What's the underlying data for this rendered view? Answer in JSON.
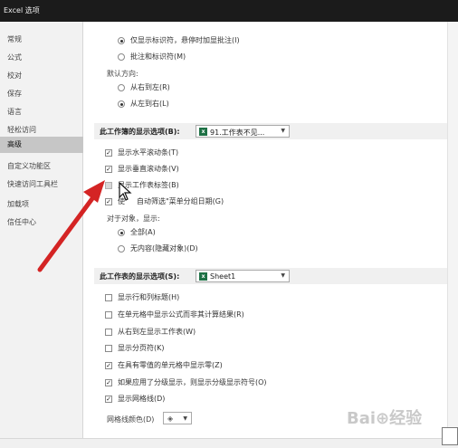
{
  "window": {
    "title": "Excel 选项"
  },
  "sidebar": {
    "items": [
      {
        "label": "常规"
      },
      {
        "label": "公式"
      },
      {
        "label": "校对"
      },
      {
        "label": "保存"
      },
      {
        "label": "语言"
      },
      {
        "label": "轻松访问"
      },
      {
        "label": "高级",
        "active": true
      },
      {
        "label": "自定义功能区"
      },
      {
        "label": "快速访问工具栏"
      },
      {
        "label": "加载项"
      },
      {
        "label": "信任中心"
      }
    ]
  },
  "comments_section": {
    "option_indicators_only": "仅显示标识符，悬停时加显批注(I)",
    "option_comments_and_indicators": "批注和标识符(M)"
  },
  "direction_section": {
    "label": "默认方向:",
    "option_right_to_left": "从右到左(R)",
    "option_left_to_right": "从左到右(L)"
  },
  "workbook_display": {
    "header": "此工作簿的显示选项(B):",
    "selected": "91.工作表不见...",
    "show_horizontal_scrollbar": "显示水平滚动条(T)",
    "show_vertical_scrollbar": "显示垂直滚动条(V)",
    "show_sheet_tabs": "显示工作表标签(B)",
    "group_dates_prefix": "使",
    "group_dates_suffix": "自动筛选\"菜单分组日期(G)",
    "for_objects_label": "对于对象，显示:",
    "objects_all": "全部(A)",
    "objects_none": "无内容(隐藏对象)(D)"
  },
  "worksheet_display": {
    "header": "此工作表的显示选项(S):",
    "selected": "Sheet1",
    "show_row_col_headers": "显示行和列标题(H)",
    "show_formulas": "在单元格中显示公式而非其计算结果(R)",
    "right_to_left": "从右到左显示工作表(W)",
    "show_page_breaks": "显示分页符(K)",
    "show_zero": "在具有零值的单元格中显示零(Z)",
    "show_outline_symbols": "如果应用了分级显示，则显示分级显示符号(O)",
    "show_gridlines": "显示网格线(D)",
    "gridline_color_label": "网格线颜色(D)"
  },
  "watermark": "Bai⊕经验",
  "colors": {
    "arrow": "#d42424",
    "titlebar": "#1b1b1b",
    "excel_green": "#1e7145"
  },
  "icons": {
    "workbook": "excel-workbook-icon",
    "sheet": "excel-sheet-icon",
    "color": "paint-bucket-icon",
    "cursor": "mouse-cursor-icon",
    "annotation": "red-arrow-icon"
  }
}
